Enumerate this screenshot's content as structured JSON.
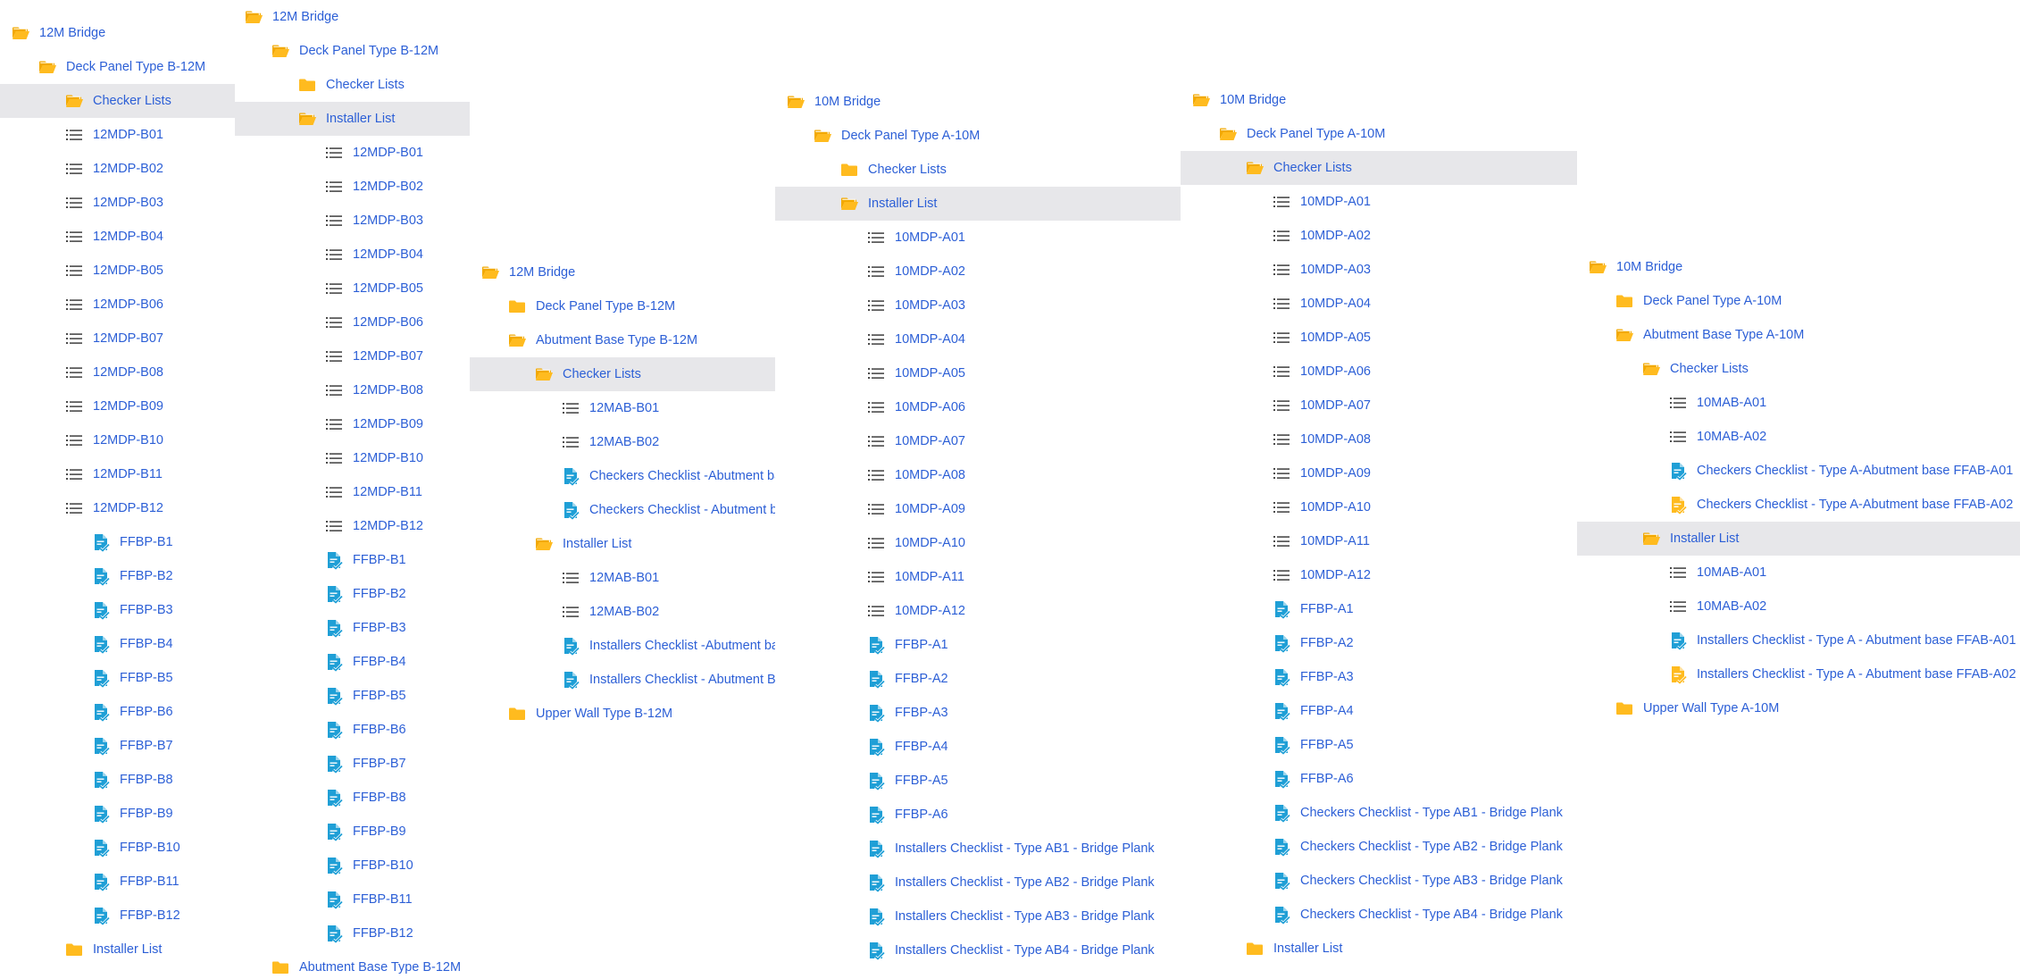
{
  "colors": {
    "link": "#2c5fd6",
    "folder": "#ffbb1f",
    "folder_dark": "#f2a900",
    "list_icon": "#4a4a4a",
    "doc_blue": "#1f9fd6",
    "doc_yellow": "#ffbb1f",
    "selected_bg": "#e7e7ea"
  },
  "panels": [
    {
      "id": "p1",
      "items": [
        {
          "label": "12M Bridge",
          "icon": "folder-open-icon"
        },
        {
          "label": "Deck Panel Type B-12M",
          "icon": "folder-open-icon"
        },
        {
          "label": "Checker Lists",
          "icon": "folder-open-icon",
          "selected": true
        },
        {
          "label": "12MDP-B01",
          "icon": "list-icon"
        },
        {
          "label": "12MDP-B02",
          "icon": "list-icon"
        },
        {
          "label": "12MDP-B03",
          "icon": "list-icon"
        },
        {
          "label": "12MDP-B04",
          "icon": "list-icon"
        },
        {
          "label": "12MDP-B05",
          "icon": "list-icon"
        },
        {
          "label": "12MDP-B06",
          "icon": "list-icon"
        },
        {
          "label": "12MDP-B07",
          "icon": "list-icon"
        },
        {
          "label": "12MDP-B08",
          "icon": "list-icon"
        },
        {
          "label": "12MDP-B09",
          "icon": "list-icon"
        },
        {
          "label": "12MDP-B10",
          "icon": "list-icon"
        },
        {
          "label": "12MDP-B11",
          "icon": "list-icon"
        },
        {
          "label": "12MDP-B12",
          "icon": "list-icon"
        },
        {
          "label": "FFBP-B1",
          "icon": "checklist-doc-icon"
        },
        {
          "label": "FFBP-B2",
          "icon": "checklist-doc-icon"
        },
        {
          "label": "FFBP-B3",
          "icon": "checklist-doc-icon"
        },
        {
          "label": "FFBP-B4",
          "icon": "checklist-doc-icon"
        },
        {
          "label": "FFBP-B5",
          "icon": "checklist-doc-icon"
        },
        {
          "label": "FFBP-B6",
          "icon": "checklist-doc-icon"
        },
        {
          "label": "FFBP-B7",
          "icon": "checklist-doc-icon"
        },
        {
          "label": "FFBP-B8",
          "icon": "checklist-doc-icon"
        },
        {
          "label": "FFBP-B9",
          "icon": "checklist-doc-icon"
        },
        {
          "label": "FFBP-B10",
          "icon": "checklist-doc-icon"
        },
        {
          "label": "FFBP-B11",
          "icon": "checklist-doc-icon"
        },
        {
          "label": "FFBP-B12",
          "icon": "checklist-doc-icon"
        },
        {
          "label": "Installer List",
          "icon": "folder-icon"
        }
      ]
    },
    {
      "id": "p2",
      "items": [
        {
          "label": "12M Bridge",
          "icon": "folder-open-icon"
        },
        {
          "label": "Deck Panel Type B-12M",
          "icon": "folder-open-icon"
        },
        {
          "label": "Checker Lists",
          "icon": "folder-icon"
        },
        {
          "label": "Installer List",
          "icon": "folder-open-icon",
          "selected": true
        },
        {
          "label": "12MDP-B01",
          "icon": "list-icon"
        },
        {
          "label": "12MDP-B02",
          "icon": "list-icon"
        },
        {
          "label": "12MDP-B03",
          "icon": "list-icon"
        },
        {
          "label": "12MDP-B04",
          "icon": "list-icon"
        },
        {
          "label": "12MDP-B05",
          "icon": "list-icon"
        },
        {
          "label": "12MDP-B06",
          "icon": "list-icon"
        },
        {
          "label": "12MDP-B07",
          "icon": "list-icon"
        },
        {
          "label": "12MDP-B08",
          "icon": "list-icon"
        },
        {
          "label": "12MDP-B09",
          "icon": "list-icon"
        },
        {
          "label": "12MDP-B10",
          "icon": "list-icon"
        },
        {
          "label": "12MDP-B11",
          "icon": "list-icon"
        },
        {
          "label": "12MDP-B12",
          "icon": "list-icon"
        },
        {
          "label": "FFBP-B1",
          "icon": "checklist-doc-icon"
        },
        {
          "label": "FFBP-B2",
          "icon": "checklist-doc-icon"
        },
        {
          "label": "FFBP-B3",
          "icon": "checklist-doc-icon"
        },
        {
          "label": "FFBP-B4",
          "icon": "checklist-doc-icon"
        },
        {
          "label": "FFBP-B5",
          "icon": "checklist-doc-icon"
        },
        {
          "label": "FFBP-B6",
          "icon": "checklist-doc-icon"
        },
        {
          "label": "FFBP-B7",
          "icon": "checklist-doc-icon"
        },
        {
          "label": "FFBP-B8",
          "icon": "checklist-doc-icon"
        },
        {
          "label": "FFBP-B9",
          "icon": "checklist-doc-icon"
        },
        {
          "label": "FFBP-B10",
          "icon": "checklist-doc-icon"
        },
        {
          "label": "FFBP-B11",
          "icon": "checklist-doc-icon"
        },
        {
          "label": "FFBP-B12",
          "icon": "checklist-doc-icon"
        },
        {
          "label": "Abutment Base Type B-12M",
          "icon": "folder-icon"
        }
      ]
    },
    {
      "id": "p3",
      "items": [
        {
          "label": "12M Bridge",
          "icon": "folder-open-icon"
        },
        {
          "label": "Deck Panel Type B-12M",
          "icon": "folder-icon"
        },
        {
          "label": "Abutment Base Type B-12M",
          "icon": "folder-open-icon"
        },
        {
          "label": "Checker Lists",
          "icon": "folder-open-icon",
          "selected": true
        },
        {
          "label": "12MAB-B01",
          "icon": "list-icon"
        },
        {
          "label": "12MAB-B02",
          "icon": "list-icon"
        },
        {
          "label": "Checkers Checklist -Abutment bas",
          "icon": "checklist-doc-icon"
        },
        {
          "label": "Checkers Checklist - Abutment ba",
          "icon": "checklist-doc-icon"
        },
        {
          "label": "Installer List",
          "icon": "folder-open-icon"
        },
        {
          "label": "12MAB-B01",
          "icon": "list-icon"
        },
        {
          "label": "12MAB-B02",
          "icon": "list-icon"
        },
        {
          "label": "Installers Checklist -Abutment bas",
          "icon": "checklist-doc-icon"
        },
        {
          "label": "Installers Checklist - Abutment Ba",
          "icon": "checklist-doc-icon"
        },
        {
          "label": "Upper Wall Type B-12M",
          "icon": "folder-icon"
        }
      ]
    },
    {
      "id": "p4",
      "items": [
        {
          "label": "10M Bridge",
          "icon": "folder-open-icon"
        },
        {
          "label": "Deck Panel Type A-10M",
          "icon": "folder-open-icon"
        },
        {
          "label": "Checker Lists",
          "icon": "folder-icon"
        },
        {
          "label": "Installer List",
          "icon": "folder-open-icon",
          "selected": true
        },
        {
          "label": "10MDP-A01",
          "icon": "list-icon"
        },
        {
          "label": "10MDP-A02",
          "icon": "list-icon"
        },
        {
          "label": "10MDP-A03",
          "icon": "list-icon"
        },
        {
          "label": "10MDP-A04",
          "icon": "list-icon"
        },
        {
          "label": "10MDP-A05",
          "icon": "list-icon"
        },
        {
          "label": "10MDP-A06",
          "icon": "list-icon"
        },
        {
          "label": "10MDP-A07",
          "icon": "list-icon"
        },
        {
          "label": "10MDP-A08",
          "icon": "list-icon"
        },
        {
          "label": "10MDP-A09",
          "icon": "list-icon"
        },
        {
          "label": "10MDP-A10",
          "icon": "list-icon"
        },
        {
          "label": "10MDP-A11",
          "icon": "list-icon"
        },
        {
          "label": "10MDP-A12",
          "icon": "list-icon"
        },
        {
          "label": "FFBP-A1",
          "icon": "checklist-doc-icon"
        },
        {
          "label": "FFBP-A2",
          "icon": "checklist-doc-icon"
        },
        {
          "label": "FFBP-A3",
          "icon": "checklist-doc-icon"
        },
        {
          "label": "FFBP-A4",
          "icon": "checklist-doc-icon"
        },
        {
          "label": "FFBP-A5",
          "icon": "checklist-doc-icon"
        },
        {
          "label": "FFBP-A6",
          "icon": "checklist-doc-icon"
        },
        {
          "label": "Installers Checklist - Type AB1 - Bridge Plank",
          "icon": "checklist-doc-icon"
        },
        {
          "label": "Installers Checklist - Type AB2 - Bridge Plank",
          "icon": "checklist-doc-icon"
        },
        {
          "label": "Installers Checklist - Type AB3 - Bridge Plank",
          "icon": "checklist-doc-icon"
        },
        {
          "label": "Installers Checklist - Type AB4 - Bridge Plank",
          "icon": "checklist-doc-icon"
        }
      ]
    },
    {
      "id": "p5",
      "items": [
        {
          "label": "10M Bridge",
          "icon": "folder-open-icon"
        },
        {
          "label": "Deck Panel Type A-10M",
          "icon": "folder-open-icon"
        },
        {
          "label": "Checker Lists",
          "icon": "folder-open-icon",
          "selected": true
        },
        {
          "label": "10MDP-A01",
          "icon": "list-icon"
        },
        {
          "label": "10MDP-A02",
          "icon": "list-icon"
        },
        {
          "label": "10MDP-A03",
          "icon": "list-icon"
        },
        {
          "label": "10MDP-A04",
          "icon": "list-icon"
        },
        {
          "label": "10MDP-A05",
          "icon": "list-icon"
        },
        {
          "label": "10MDP-A06",
          "icon": "list-icon"
        },
        {
          "label": "10MDP-A07",
          "icon": "list-icon"
        },
        {
          "label": "10MDP-A08",
          "icon": "list-icon"
        },
        {
          "label": "10MDP-A09",
          "icon": "list-icon"
        },
        {
          "label": "10MDP-A10",
          "icon": "list-icon"
        },
        {
          "label": "10MDP-A11",
          "icon": "list-icon"
        },
        {
          "label": "10MDP-A12",
          "icon": "list-icon"
        },
        {
          "label": "FFBP-A1",
          "icon": "checklist-doc-icon"
        },
        {
          "label": "FFBP-A2",
          "icon": "checklist-doc-icon"
        },
        {
          "label": "FFBP-A3",
          "icon": "checklist-doc-icon"
        },
        {
          "label": "FFBP-A4",
          "icon": "checklist-doc-icon"
        },
        {
          "label": "FFBP-A5",
          "icon": "checklist-doc-icon"
        },
        {
          "label": "FFBP-A6",
          "icon": "checklist-doc-icon"
        },
        {
          "label": "Checkers Checklist - Type AB1 - Bridge Plank",
          "icon": "checklist-doc-icon"
        },
        {
          "label": "Checkers Checklist - Type AB2 - Bridge Plank",
          "icon": "checklist-doc-icon"
        },
        {
          "label": "Checkers Checklist - Type AB3 - Bridge Plank",
          "icon": "checklist-doc-icon"
        },
        {
          "label": "Checkers Checklist - Type AB4 - Bridge Plank",
          "icon": "checklist-doc-icon"
        },
        {
          "label": "Installer List",
          "icon": "folder-icon"
        }
      ]
    },
    {
      "id": "p6",
      "items": [
        {
          "label": "10M Bridge",
          "icon": "folder-open-icon"
        },
        {
          "label": "Deck Panel Type A-10M",
          "icon": "folder-icon"
        },
        {
          "label": "Abutment Base Type A-10M",
          "icon": "folder-open-icon"
        },
        {
          "label": "Checker Lists",
          "icon": "folder-open-icon"
        },
        {
          "label": "10MAB-A01",
          "icon": "list-icon"
        },
        {
          "label": "10MAB-A02",
          "icon": "list-icon"
        },
        {
          "label": "Checkers Checklist - Type A-Abutment base FFAB-A01",
          "icon": "checklist-doc-icon"
        },
        {
          "label": "Checkers Checklist - Type A-Abutment base FFAB-A02",
          "icon": "checklist-doc-yellow-icon"
        },
        {
          "label": "Installer List",
          "icon": "folder-open-icon",
          "selected": true
        },
        {
          "label": "10MAB-A01",
          "icon": "list-icon"
        },
        {
          "label": "10MAB-A02",
          "icon": "list-icon"
        },
        {
          "label": "Installers Checklist - Type A - Abutment base FFAB-A01",
          "icon": "checklist-doc-icon"
        },
        {
          "label": "Installers Checklist - Type A - Abutment base FFAB-A02",
          "icon": "checklist-doc-yellow-icon"
        },
        {
          "label": "Upper Wall Type A-10M",
          "icon": "folder-icon"
        }
      ]
    }
  ]
}
